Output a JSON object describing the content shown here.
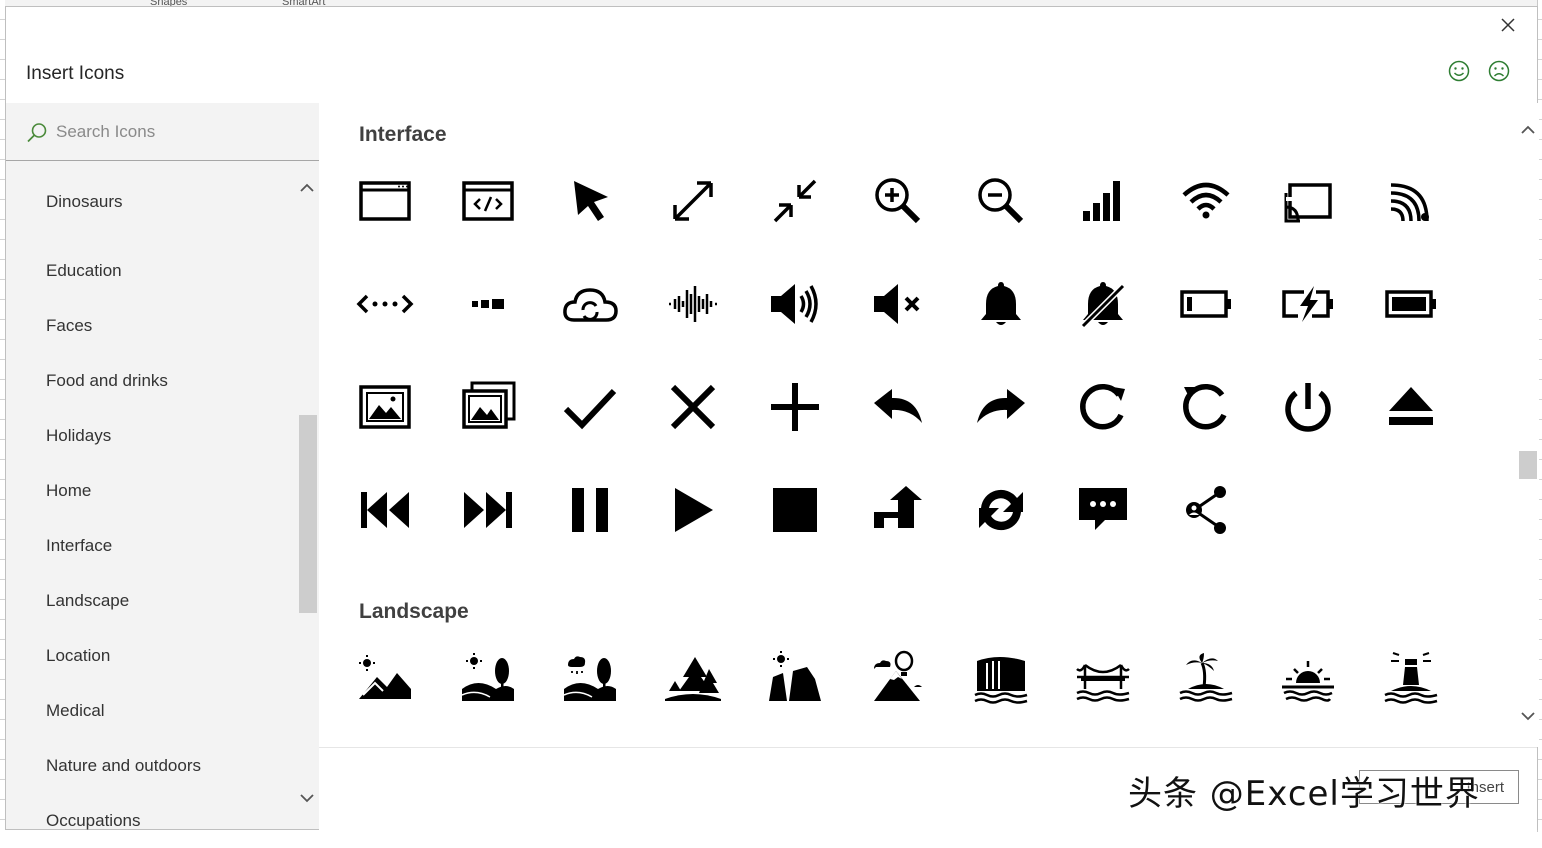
{
  "window": {
    "title": "Insert Icons"
  },
  "background": {
    "ribbon_labels": [
      "Shapes",
      "SmartArt"
    ]
  },
  "search": {
    "placeholder": "Search Icons"
  },
  "categories": [
    "Dinosaurs",
    "Education",
    "Faces",
    "Food and drinks",
    "Holidays",
    "Home",
    "Interface",
    "Landscape",
    "Location",
    "Medical",
    "Nature and outdoors",
    "Occupations"
  ],
  "sections": [
    {
      "title": "Interface",
      "icons": [
        "browser-window-icon",
        "code-window-icon",
        "cursor-arrow-icon",
        "expand-icon",
        "collapse-icon",
        "zoom-in-icon",
        "zoom-out-icon",
        "signal-bars-icon",
        "wifi-icon",
        "cast-icon",
        "wireless-signal-icon",
        "connection-dots-icon",
        "progress-dots-icon",
        "cloud-sync-icon",
        "audio-wave-icon",
        "volume-icon",
        "mute-icon",
        "bell-icon",
        "bell-off-icon",
        "battery-low-icon",
        "battery-charging-icon",
        "battery-full-icon",
        "picture-icon",
        "pictures-icon",
        "checkmark-icon",
        "x-mark-icon",
        "plus-icon",
        "undo-icon",
        "redo-icon",
        "refresh-icon",
        "rotate-left-icon",
        "power-icon",
        "eject-icon",
        "skip-back-icon",
        "skip-forward-icon",
        "pause-icon",
        "play-icon",
        "stop-icon",
        "turn-up-icon",
        "sync-icon",
        "chat-bubble-icon",
        "share-icon"
      ]
    },
    {
      "title": "Landscape",
      "icons": [
        "mountains-sun-icon",
        "hills-tree-icon",
        "hills-rain-icon",
        "forest-icon",
        "cliff-icon",
        "balloon-mountain-icon",
        "waterfall-icon",
        "bridge-icon",
        "island-icon",
        "sunset-sea-icon",
        "lighthouse-icon"
      ]
    }
  ],
  "footer": {
    "insert_label": "Insert"
  },
  "watermark": {
    "text": "头条 @Excel学习世界"
  },
  "colors": {
    "sidebar_bg": "#f3f3f3",
    "icon": "#000000",
    "search_icon": "#4a8a3a"
  }
}
